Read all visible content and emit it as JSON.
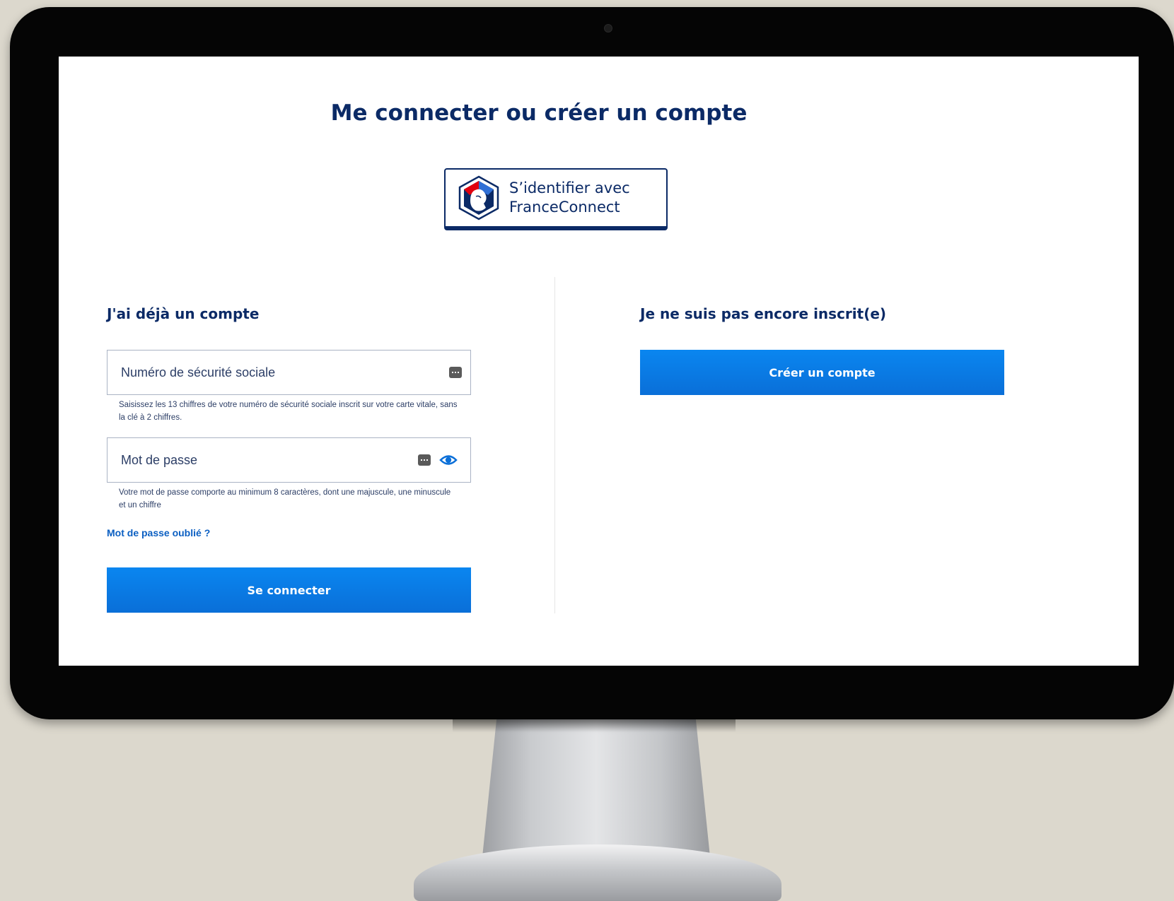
{
  "page": {
    "title": "Me connecter ou créer un compte"
  },
  "franceconnect": {
    "line1": "S’identifier avec",
    "line2": "FranceConnect"
  },
  "login": {
    "section_title": "J'ai déjà un compte",
    "ssn_placeholder": "Numéro de sécurité sociale",
    "ssn_hint": "Saisissez les 13 chiffres de votre numéro de sécurité sociale inscrit sur votre carte vitale, sans la clé à 2 chiffres.",
    "password_placeholder": "Mot de passe",
    "password_hint": "Votre mot de passe comporte au minimum 8 caractères, dont une majuscule, une minuscule et un chiffre",
    "forgot_label": "Mot de passe oublié ?",
    "submit_label": "Se connecter"
  },
  "register": {
    "section_title": "Je ne suis pas encore inscrit(e)",
    "create_label": "Créer un compte"
  },
  "icons": {
    "keypad": "keypad-icon",
    "eye": "eye-icon",
    "franceconnect_logo": "franceconnect-logo"
  },
  "colors": {
    "primary": "#0a7ae8",
    "title": "#0b2a66",
    "link": "#0b5fc2"
  }
}
